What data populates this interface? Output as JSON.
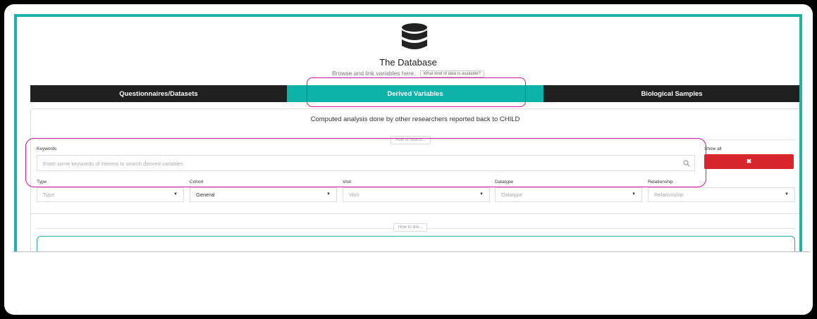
{
  "header": {
    "icon": "database-icon",
    "title": "The Database",
    "subtitle": "Browse and link variables here.",
    "info_button": "What kind of data is available?"
  },
  "tabs": [
    {
      "label": "Questionnaires/Datasets",
      "active": false
    },
    {
      "label": "Derived Variables",
      "active": true
    },
    {
      "label": "Biological Samples",
      "active": false
    }
  ],
  "panel": {
    "description": "Computed analysis done by other researchers reported back to CHILD",
    "how_to_search": "How to search...",
    "keywords_label": "Keywords",
    "keywords_placeholder": "Enter some keywords of interest to search derived variables",
    "show_all_label": "Show all",
    "clear_button": "✖",
    "how_to_link": "How to link..."
  },
  "filters": [
    {
      "label": "Type",
      "value": "Type",
      "placeholder": true
    },
    {
      "label": "Cohort",
      "value": "General",
      "placeholder": false
    },
    {
      "label": "Visit",
      "value": "Visit",
      "placeholder": true
    },
    {
      "label": "Datatype",
      "value": "Datatype",
      "placeholder": true
    },
    {
      "label": "Relationship",
      "value": "Relationship",
      "placeholder": true
    }
  ],
  "colors": {
    "accent": "#0db3a8",
    "tab_dark": "#202020",
    "danger": "#d9262c",
    "highlight": "#d0139a"
  }
}
